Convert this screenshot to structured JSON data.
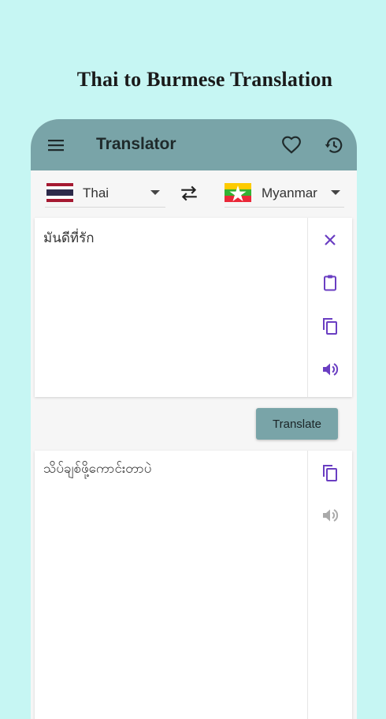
{
  "promo": {
    "title": "Thai to Burmese Translation"
  },
  "appbar": {
    "title": "Translator"
  },
  "languages": {
    "source": {
      "label": "Thai"
    },
    "target": {
      "label": "Myanmar"
    }
  },
  "input": {
    "text": "มันดีที่รัก"
  },
  "actions": {
    "translate_label": "Translate"
  },
  "output": {
    "text": "သိပ်ချစ်ဖို့ကောင်းတာပဲ"
  },
  "colors": {
    "background": "#c6f6f3",
    "appbar": "#79a4a8",
    "accent_icon": "#6a3ec2",
    "disabled_icon": "#aaaaaa"
  },
  "icons": [
    "menu-icon",
    "heart-icon",
    "history-icon",
    "thailand-flag-icon",
    "swap-icon",
    "myanmar-flag-icon",
    "close-icon",
    "paste-icon",
    "copy-icon",
    "speaker-icon"
  ]
}
